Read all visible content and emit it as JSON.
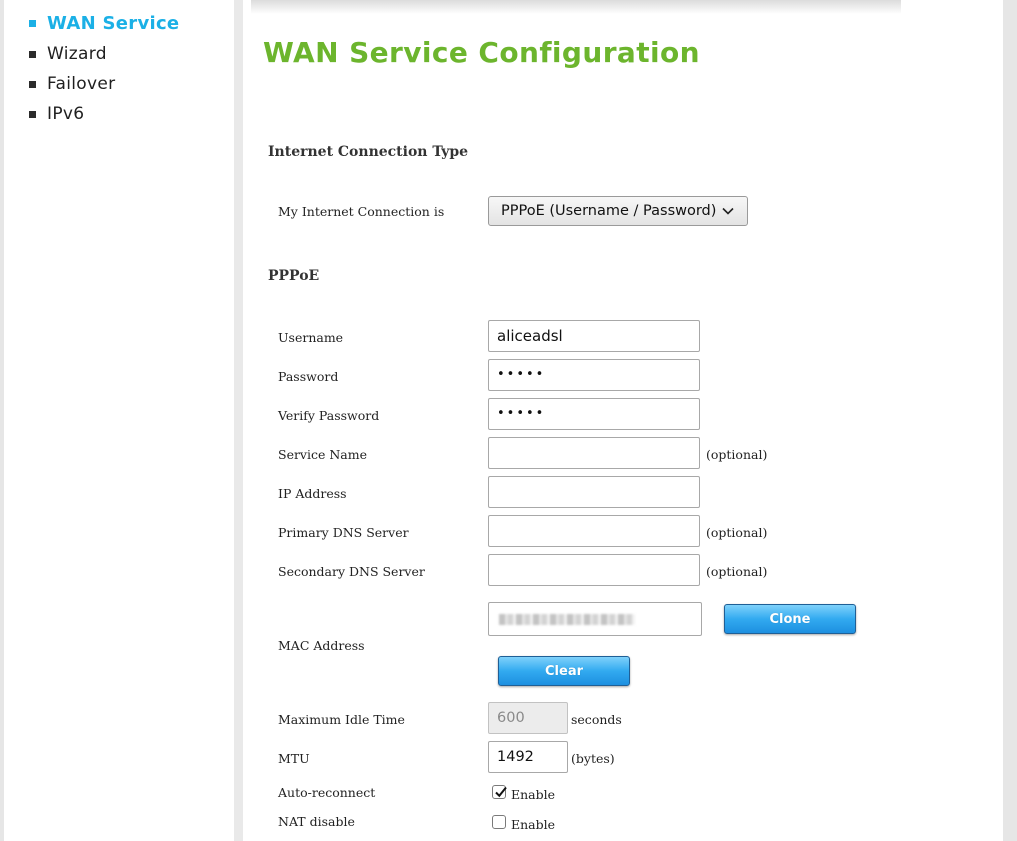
{
  "sidebar": {
    "items": [
      {
        "label": "WAN Service",
        "active": true
      },
      {
        "label": "Wizard",
        "active": false
      },
      {
        "label": "Failover",
        "active": false
      },
      {
        "label": "IPv6",
        "active": false
      }
    ],
    "active_color": "#1bb0e6"
  },
  "main": {
    "title": "WAN Service Configuration",
    "title_color": "#6cb52d",
    "connection_section": {
      "heading": "Internet Connection Type",
      "label": "My Internet Connection is",
      "selected": "PPPoE (Username / Password)",
      "dropdown_icon": "chevron-down-icon"
    },
    "pppoe_section": {
      "heading": "PPPoE",
      "username_label": "Username",
      "username_value": "aliceadsl",
      "password_label": "Password",
      "password_value": "•••••",
      "verify_label": "Verify Password",
      "verify_value": "•••••",
      "service_name_label": "Service Name",
      "service_name_value": "",
      "service_name_hint": "(optional)",
      "ip_label": "IP Address",
      "ip_value": "",
      "primary_dns_label": "Primary DNS Server",
      "primary_dns_value": "",
      "primary_dns_hint": "(optional)",
      "secondary_dns_label": "Secondary DNS Server",
      "secondary_dns_value": "",
      "secondary_dns_hint": "(optional)",
      "mac_label": "MAC Address",
      "clone_label": "Clone",
      "clear_label": "Clear",
      "idle_label": "Maximum Idle Time",
      "idle_value": "600",
      "idle_unit": "seconds",
      "mtu_label": "MTU",
      "mtu_value": "1492",
      "mtu_unit": "(bytes)",
      "autoreconnect_label": "Auto-reconnect",
      "autoreconnect_checked": true,
      "autoreconnect_option": "Enable",
      "nat_label": "NAT disable",
      "nat_checked": false,
      "nat_option": "Enable"
    }
  }
}
